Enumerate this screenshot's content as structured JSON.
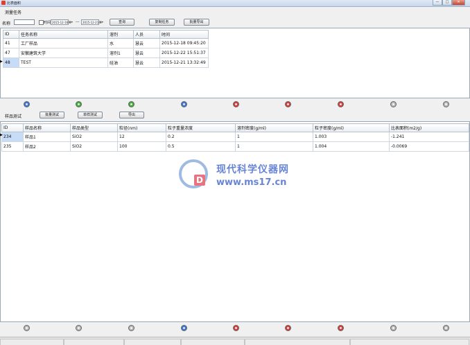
{
  "window": {
    "title": "比表面积",
    "controls": [
      "—",
      "□",
      "✕"
    ]
  },
  "task_section": {
    "heading": "测量任务",
    "name_label": "名称",
    "name_value": "",
    "time_label": "时间",
    "date_from": "2015-12-16",
    "date_sep": "---",
    "date_to": "2015-12-21",
    "query_btn": "查询",
    "copy_btn": "复制任务",
    "export_btn": "批量导出",
    "columns": [
      "ID",
      "任务名称",
      "溶剂",
      "人员",
      "时间"
    ],
    "rows": [
      [
        "41",
        "工厂样品",
        "水",
        "慧云",
        "2015-12-18 09:45:20"
      ],
      [
        "47",
        "安徽建筑大学",
        "溶剂1",
        "慧云",
        "2015-12-22 15:51:37"
      ],
      [
        "48",
        "TEST",
        "硅油",
        "慧云",
        "2015-12-21 13:32:49"
      ]
    ]
  },
  "sample_section": {
    "heading": "样品测试",
    "batch_btn": "批量测试",
    "single_btn": "单样测试",
    "export_btn": "导出",
    "columns": [
      "ID",
      "样品名称",
      "样品类型",
      "粒径(nm)",
      "粒子重量浓度",
      "溶剂密度(g/ml)",
      "粒子密度(g/ml)",
      "比表面积(m2/g)"
    ],
    "rows": [
      [
        "234",
        "样品1",
        "SiO2",
        "12",
        "0.2",
        "1",
        "1.003",
        "-1.241"
      ],
      [
        "235",
        "样品2",
        "SiO2",
        "100",
        "0.5",
        "1",
        "1.004",
        "-0.0069"
      ]
    ]
  },
  "led_row_1": [
    "blue",
    "green",
    "green",
    "blue",
    "red",
    "red",
    "red",
    "gray",
    "gray"
  ],
  "led_row_2": [
    "gray",
    "gray",
    "gray",
    "blue",
    "red",
    "red",
    "red",
    "gray",
    "gray"
  ],
  "led_colors": {
    "blue": "#3a78d8",
    "green": "#3fae3a",
    "red": "#d63c3c",
    "gray": "#b8b8b8"
  },
  "watermark": {
    "name": "现代科学仪器网",
    "url": "www.ms17.cn",
    "logo_letter": "D"
  }
}
